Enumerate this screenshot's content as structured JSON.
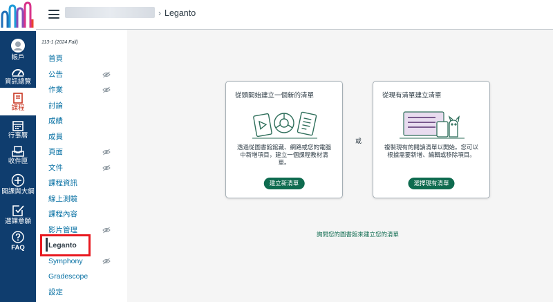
{
  "global_nav": {
    "items": [
      {
        "label": "帳戶",
        "icon": "avatar-icon"
      },
      {
        "label": "資訊總覽",
        "icon": "dashboard-icon"
      },
      {
        "label": "課程",
        "icon": "courses-icon"
      },
      {
        "label": "行事曆",
        "icon": "calendar-icon"
      },
      {
        "label": "收件匣",
        "icon": "inbox-icon"
      },
      {
        "label": "開課與大綱",
        "icon": "plus-circle-icon"
      },
      {
        "label": "選課意願",
        "icon": "checkbox-icon"
      },
      {
        "label": "FAQ",
        "icon": "help-icon"
      }
    ]
  },
  "header": {
    "breadcrumb_current": "Leganto",
    "separator": "›"
  },
  "course_nav": {
    "term": "113-1 (2024 Fall)",
    "items": [
      {
        "label": "首頁",
        "hidden": false
      },
      {
        "label": "公告",
        "hidden": true
      },
      {
        "label": "作業",
        "hidden": true
      },
      {
        "label": "討論",
        "hidden": false
      },
      {
        "label": "成績",
        "hidden": false
      },
      {
        "label": "成員",
        "hidden": false
      },
      {
        "label": "頁面",
        "hidden": true
      },
      {
        "label": "文件",
        "hidden": true
      },
      {
        "label": "課程資訊",
        "hidden": false
      },
      {
        "label": "線上測驗",
        "hidden": false
      },
      {
        "label": "課程內容",
        "hidden": false
      },
      {
        "label": "影片管理",
        "hidden": true
      },
      {
        "label": "Leganto",
        "hidden": false,
        "active": true
      },
      {
        "label": "Symphony",
        "hidden": true
      },
      {
        "label": "Gradescope",
        "hidden": false
      },
      {
        "label": "設定",
        "hidden": false
      }
    ]
  },
  "main": {
    "card_new": {
      "title": "從頭開始建立一個新的清單",
      "description": "透過從圖書館館藏、網路或您的電腦中新增項目，建立一個課程教材清單。",
      "button": "建立新清單"
    },
    "or_text": "或",
    "card_existing": {
      "title": "從現有清單建立清單",
      "description": "複製現有的閱讀清單以開始。您可以根據需要新增、編輯或移除項目。",
      "button": "選擇現有清單"
    },
    "ask_library": "詢問您的圖書館來建立您的清單"
  },
  "colors": {
    "global_nav_bg": "#0f3d6e",
    "accent_red": "#c8331f",
    "link_blue": "#0770a3",
    "button_green": "#0e6b4f",
    "highlight_box": "#e8181f"
  }
}
